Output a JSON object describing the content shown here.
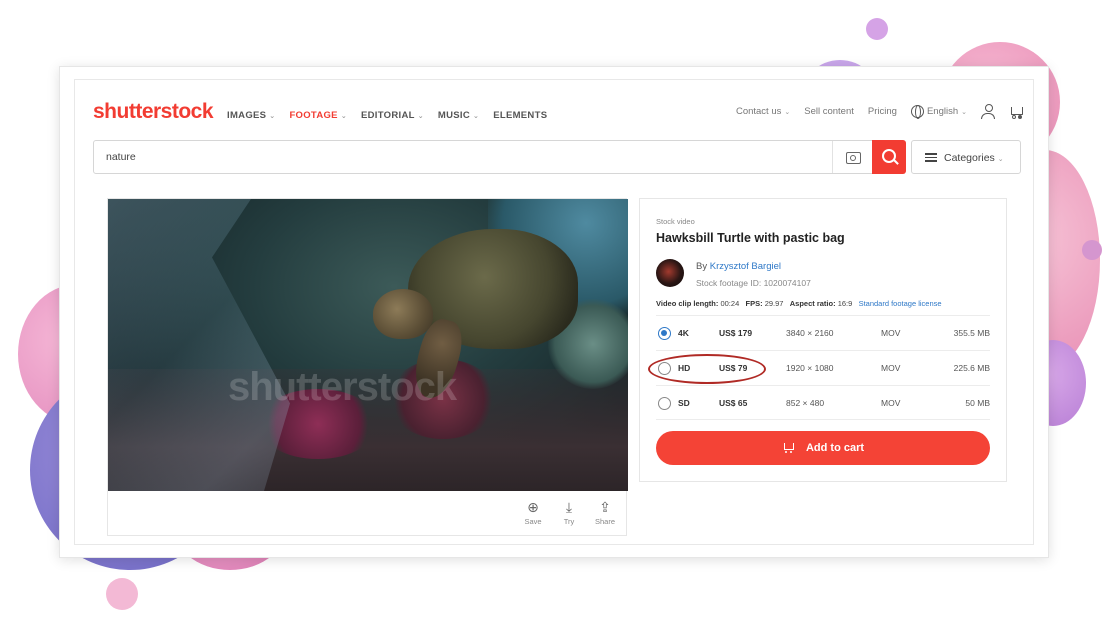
{
  "brand": {
    "logo_text": "shutterstock",
    "accent_color": "#f23c32"
  },
  "nav": {
    "links": [
      {
        "label": "IMAGES",
        "active": false,
        "has_caret": true
      },
      {
        "label": "FOOTAGE",
        "active": true,
        "has_caret": true
      },
      {
        "label": "EDITORIAL",
        "active": false,
        "has_caret": true
      },
      {
        "label": "MUSIC",
        "active": false,
        "has_caret": true
      },
      {
        "label": "ELEMENTS",
        "active": false,
        "has_caret": false
      }
    ],
    "contact_label": "Contact us",
    "sell_label": "Sell content",
    "pricing_label": "Pricing",
    "language_label": "English",
    "icons": [
      "globe-icon",
      "user-icon",
      "cart-icon"
    ]
  },
  "search": {
    "value": "nature",
    "categories_label": "Categories",
    "icons": [
      "camera-search-icon",
      "search-icon",
      "list-icon"
    ]
  },
  "video": {
    "watermark": "shutterstock",
    "actions": [
      {
        "label": "Save",
        "icon": "plus-circle-icon",
        "glyph": "⊕"
      },
      {
        "label": "Try",
        "icon": "download-icon",
        "glyph": "⤓"
      },
      {
        "label": "Share",
        "icon": "share-icon",
        "glyph": "⇪"
      }
    ]
  },
  "detail": {
    "eyebrow": "Stock video",
    "title": "Hawksbill Turtle with pastic bag",
    "by_prefix": "By",
    "author": "Krzysztof Bargiel",
    "footage_id": "Stock footage ID: 1020074107",
    "meta": {
      "clip_length_label": "Video clip length:",
      "clip_length": "00:24",
      "fps_label": "FPS:",
      "fps": "29.97",
      "aspect_label": "Aspect ratio:",
      "aspect": "16:9",
      "license": "Standard footage license"
    },
    "options": [
      {
        "res": "4K",
        "price": "US$ 179",
        "dim": "3840 × 2160",
        "format": "MOV",
        "size": "355.5 MB",
        "selected": true
      },
      {
        "res": "HD",
        "price": "US$ 79",
        "dim": "1920 × 1080",
        "format": "MOV",
        "size": "225.6 MB",
        "selected": false
      },
      {
        "res": "SD",
        "price": "US$ 65",
        "dim": "852 × 480",
        "format": "MOV",
        "size": "50 MB",
        "selected": false
      }
    ],
    "add_to_cart": "Add to cart",
    "highlighted_option": "HD",
    "highlight_color": "#b02a25",
    "button_color": "#f44336"
  }
}
